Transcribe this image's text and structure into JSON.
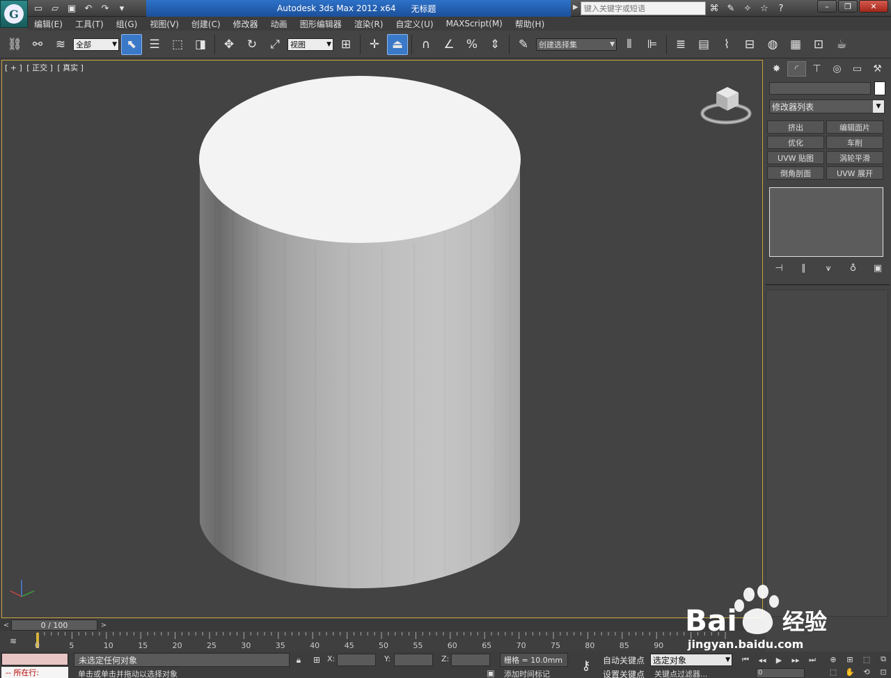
{
  "title_bar": {
    "app_name": "Autodesk 3ds Max  2012 x64",
    "document": "无标题",
    "search_placeholder": "键入关键字或短语",
    "quick_access_icons": [
      "new-file-icon",
      "open-folder-icon",
      "save-icon",
      "undo-icon",
      "redo-icon",
      "dropdown-icon"
    ],
    "window_controls": [
      "minimize-icon",
      "restore-icon",
      "close-icon"
    ]
  },
  "menu": {
    "items": [
      "编辑(E)",
      "工具(T)",
      "组(G)",
      "视图(V)",
      "创建(C)",
      "修改器",
      "动画",
      "图形编辑器",
      "渲染(R)",
      "自定义(U)",
      "MAXScript(M)",
      "帮助(H)"
    ]
  },
  "toolbar": {
    "selection_filter": "全部",
    "ref_coord": "视图",
    "named_selection": "创建选择集",
    "active_tool": "select-object"
  },
  "viewport": {
    "label": [
      "[ + ]",
      "[ 正交 ]",
      "[ 真实 ]"
    ]
  },
  "command_panel": {
    "modifier_list": "修改器列表",
    "modifier_buttons": [
      "挤出",
      "编辑面片",
      "优化",
      "车削",
      "UVW 贴图",
      "涡轮平滑",
      "倒角剖面",
      "UVW 展开"
    ]
  },
  "timeline": {
    "frame_display": "0 / 100",
    "ticks": [
      0,
      5,
      10,
      15,
      20,
      25,
      30,
      35,
      40,
      45,
      50,
      55,
      60,
      65,
      70,
      75,
      80,
      85,
      90
    ]
  },
  "status": {
    "selection_status": "未选定任何对象",
    "prompt": "单击或单击并拖动以选择对象",
    "maxscript_label": "所在行:",
    "x_label": "X:",
    "y_label": "Y:",
    "z_label": "Z:",
    "grid": "栅格 = 10.0mm",
    "add_time_tag": "添加时间标记",
    "auto_key": "自动关键点",
    "set_key": "设置关键点",
    "key_mode": "选定对象",
    "key_filters": "关键点过滤器...",
    "current_frame": "0"
  },
  "watermark": {
    "brand": "Bai",
    "brand_suffix": "经验",
    "url": "jingyan.baidu.com"
  },
  "colors": {
    "viewport_border": "#c8a23a",
    "title_blue": "#2d72c9",
    "active_tool": "#3a78c8"
  }
}
